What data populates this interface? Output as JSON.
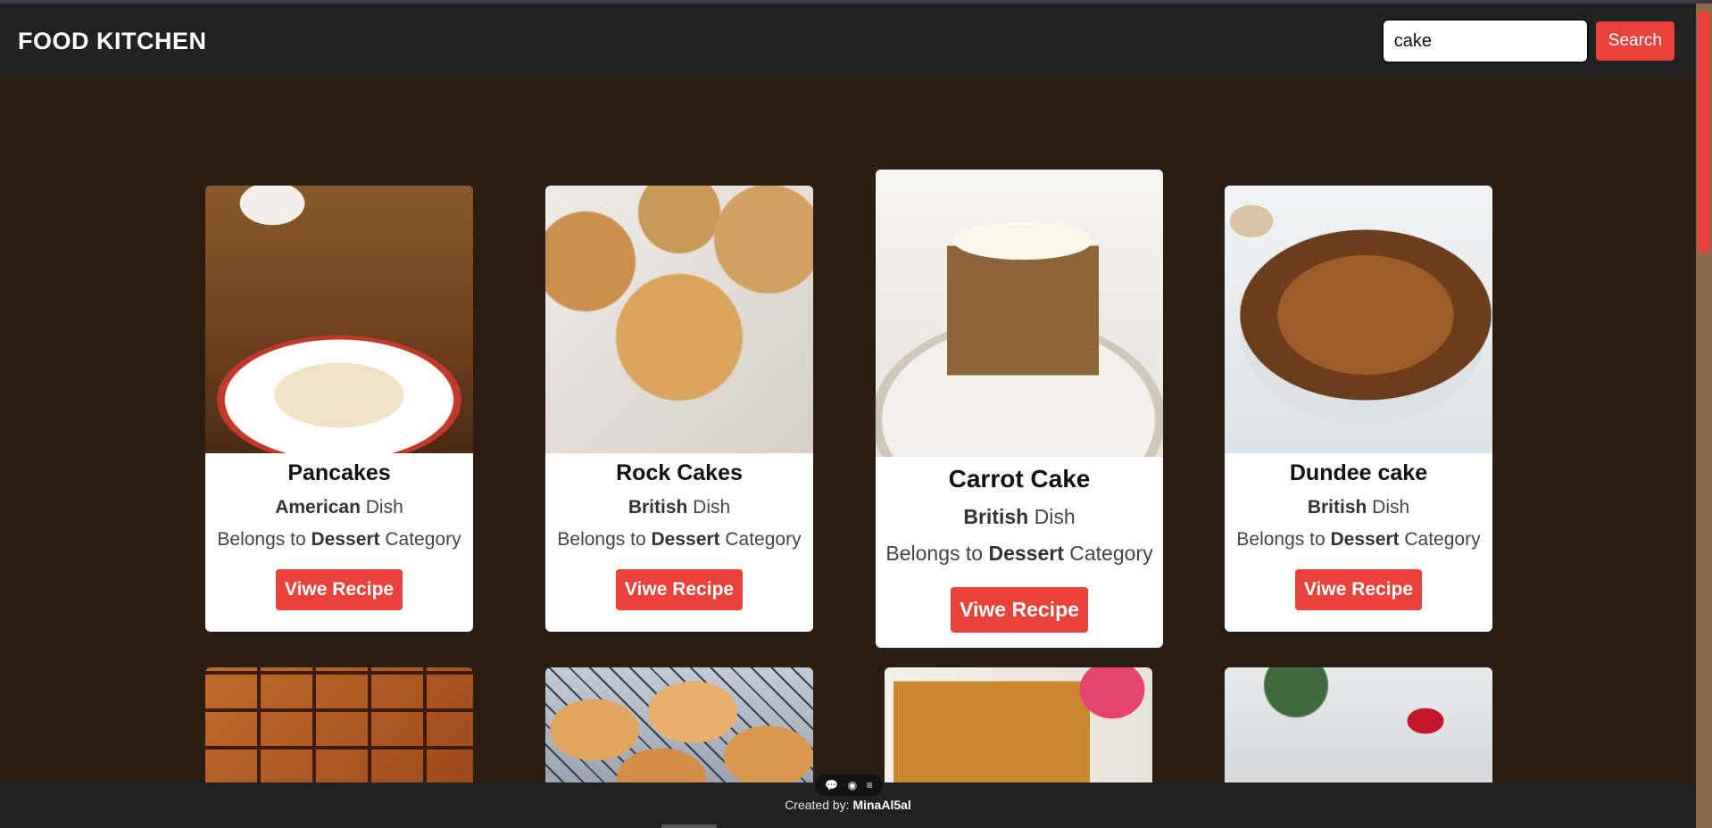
{
  "navbar": {
    "brand": "FOOD KITCHEN",
    "search": {
      "value": "cake",
      "button_label": "Search"
    }
  },
  "cards": [
    {
      "title": "Pancakes",
      "area": "American",
      "area_suffix": " Dish",
      "category_prefix": "Belongs to ",
      "category": "Dessert",
      "category_suffix": " Category",
      "button": "Viwe Recipe"
    },
    {
      "title": "Rock Cakes",
      "area": "British",
      "area_suffix": " Dish",
      "category_prefix": "Belongs to ",
      "category": "Dessert",
      "category_suffix": " Category",
      "button": "Viwe Recipe"
    },
    {
      "title": "Carrot Cake",
      "area": "British",
      "area_suffix": " Dish",
      "category_prefix": "Belongs to ",
      "category": "Dessert",
      "category_suffix": " Category",
      "button": "Viwe Recipe"
    },
    {
      "title": "Dundee cake",
      "area": "British",
      "area_suffix": " Dish",
      "category_prefix": "Belongs to ",
      "category": "Dessert",
      "category_suffix": " Category",
      "button": "Viwe Recipe"
    }
  ],
  "footer": {
    "prefix": "Created by: ",
    "author": "MinaAl5al"
  },
  "colors": {
    "accent": "#e8423a",
    "navbar": "#212121",
    "page_bg": "#2b1d12"
  },
  "icons": [
    "comment-icon",
    "eye-icon",
    "menu-icon"
  ]
}
